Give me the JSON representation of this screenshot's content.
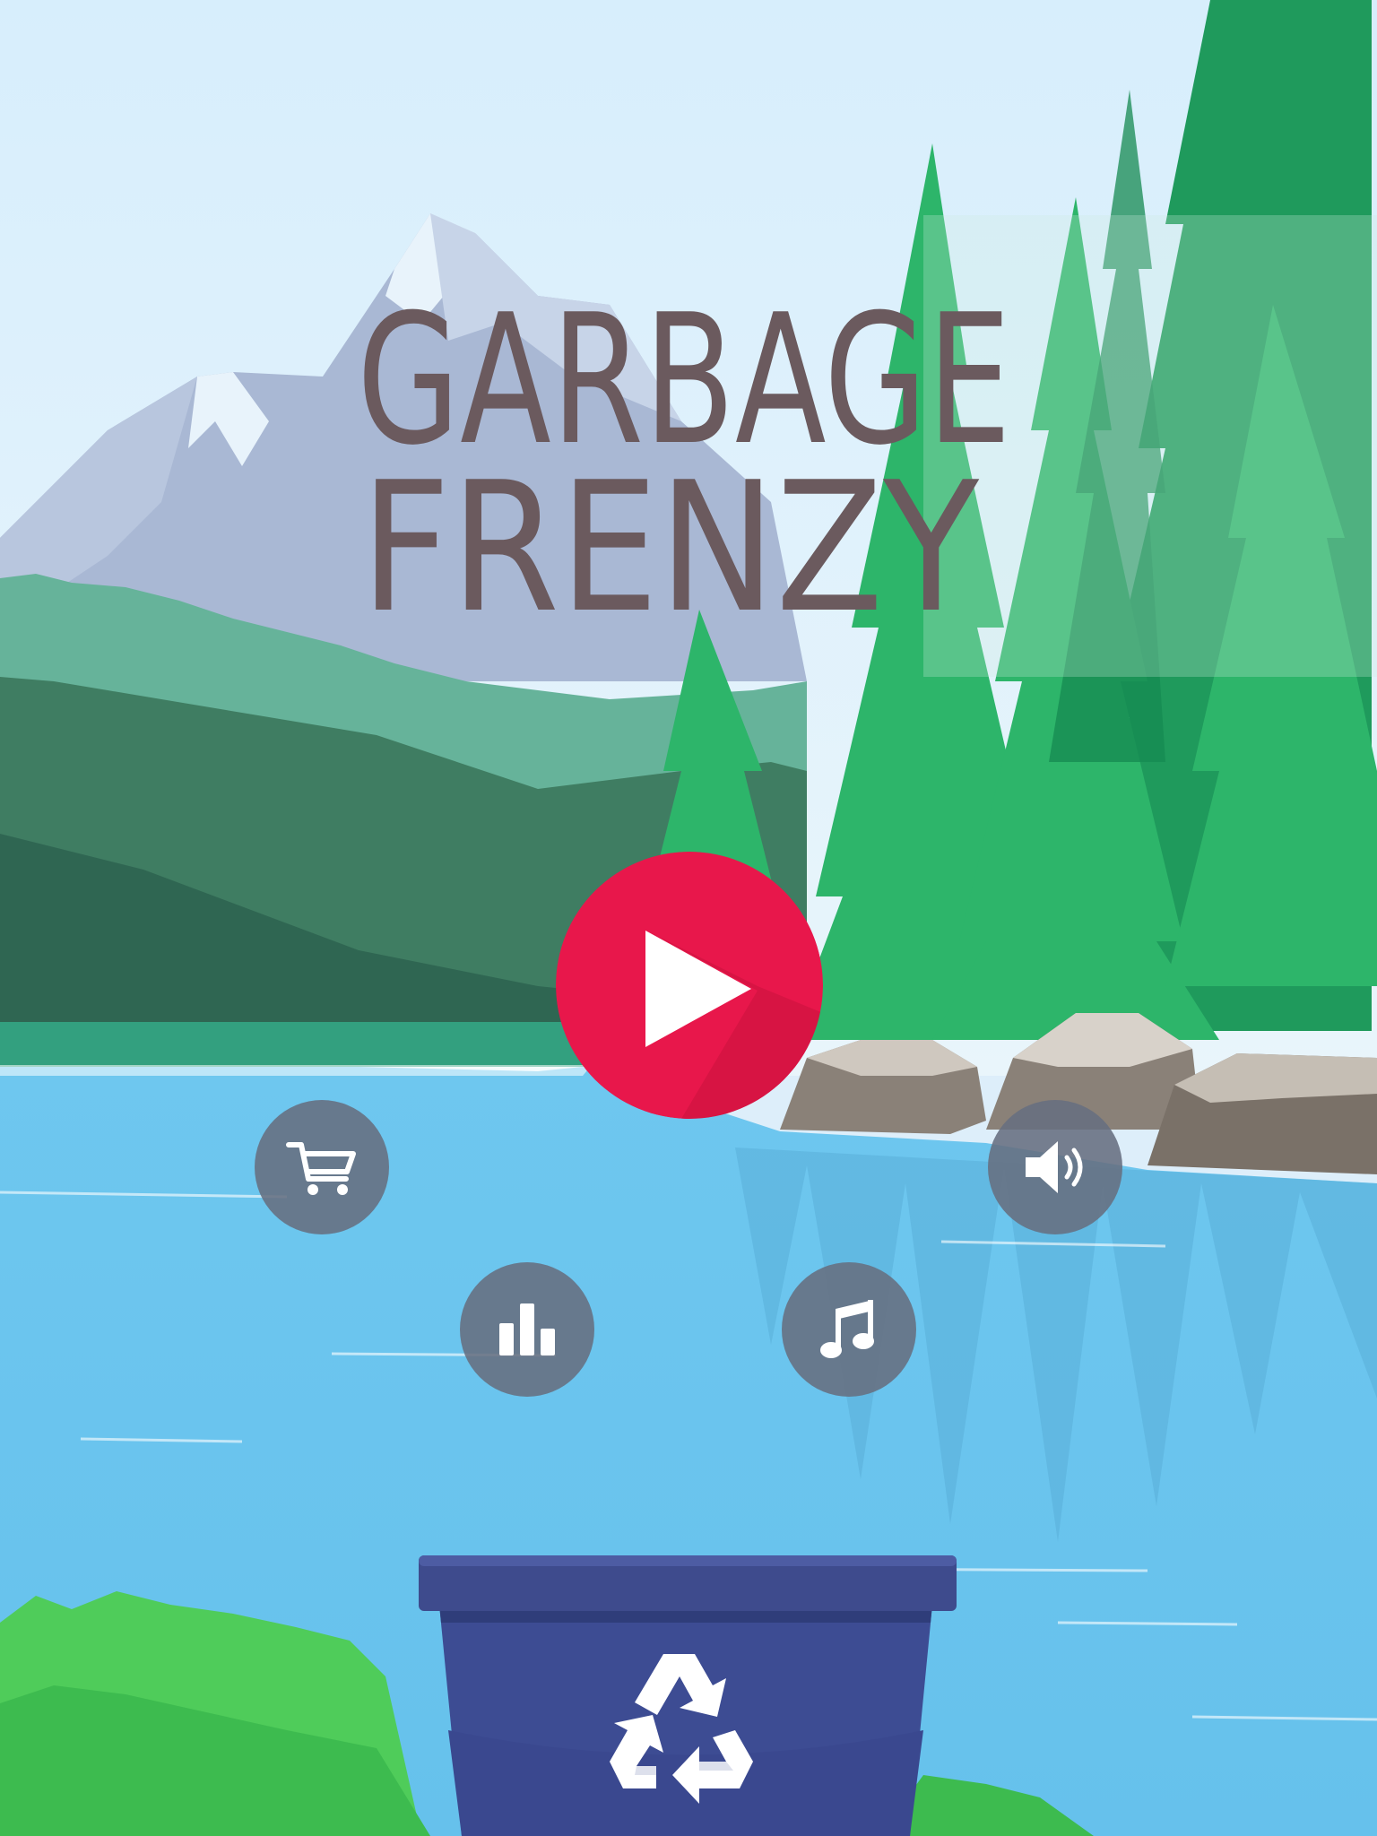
{
  "app": {
    "title_line1": "GARBAGE",
    "title_line2": "FRENZY"
  },
  "buttons": {
    "play": "play",
    "shop": "shop",
    "leaderboard": "leaderboard",
    "sound": "sound",
    "music": "music"
  },
  "icons": {
    "play": "play-icon",
    "shop": "shopping-cart-icon",
    "leaderboard": "bar-chart-icon",
    "sound": "speaker-icon",
    "music": "music-note-icon",
    "bin": "recycle-icon"
  },
  "colors": {
    "title": "#6b5a5e",
    "title_accent": "#6fb574",
    "play": "#e8174b",
    "button": "#666e80",
    "water": "#6ac4ec",
    "bin": "#3b4a91"
  }
}
